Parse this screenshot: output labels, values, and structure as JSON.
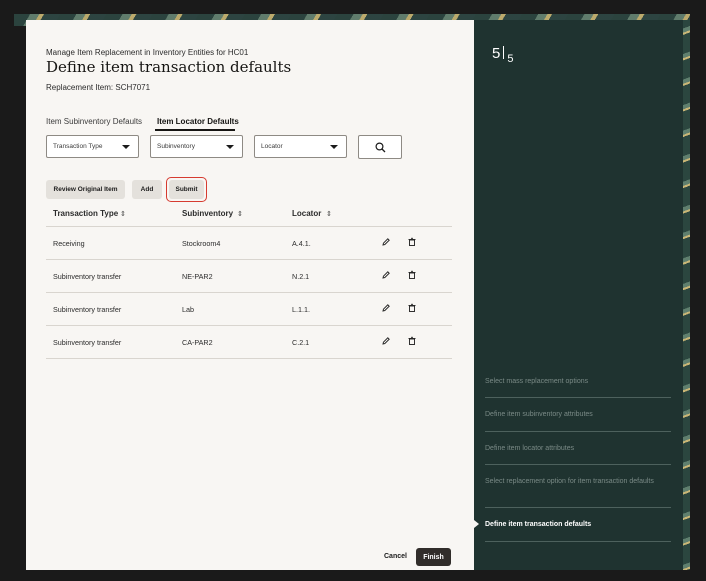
{
  "header": {
    "kicker": "Manage Item Replacement in Inventory Entities for HC01",
    "title": "Define item transaction defaults",
    "replacement_item": "Replacement Item: SCH7071"
  },
  "tabs": [
    {
      "label": "Item Subinventory Defaults",
      "active": false
    },
    {
      "label": "Item Locator Defaults",
      "active": true
    }
  ],
  "filters": {
    "transaction_type": "Transaction Type",
    "subinventory": "Subinventory",
    "locator": "Locator"
  },
  "actions": {
    "review": "Review Original Item",
    "add": "Add",
    "submit": "Submit"
  },
  "table": {
    "headers": [
      "Transaction Type",
      "Subinventory",
      "Locator"
    ],
    "rows": [
      {
        "transaction_type": "Receiving",
        "subinventory": "Stockroom4",
        "locator": "A.4.1."
      },
      {
        "transaction_type": "Subinventory transfer",
        "subinventory": "NE-PAR2",
        "locator": "N.2.1"
      },
      {
        "transaction_type": "Subinventory transfer",
        "subinventory": "Lab",
        "locator": "L.1.1."
      },
      {
        "transaction_type": "Subinventory transfer",
        "subinventory": "CA-PAR2",
        "locator": "C.2.1"
      }
    ]
  },
  "train": {
    "current": "5",
    "total": "5",
    "steps": [
      {
        "label": "Select mass replacement options",
        "current": false
      },
      {
        "label": "Define item subinventory attributes",
        "current": false
      },
      {
        "label": "Define item locator attributes",
        "current": false
      },
      {
        "label": "Select replacement option for item transaction defaults",
        "current": false
      },
      {
        "label": "Define item transaction defaults",
        "current": true
      }
    ]
  },
  "footer": {
    "cancel": "Cancel",
    "finish": "Finish"
  },
  "colors": {
    "side_panel": "#1f3330",
    "highlight": "#d63b30",
    "primary_button": "#312d2a"
  }
}
